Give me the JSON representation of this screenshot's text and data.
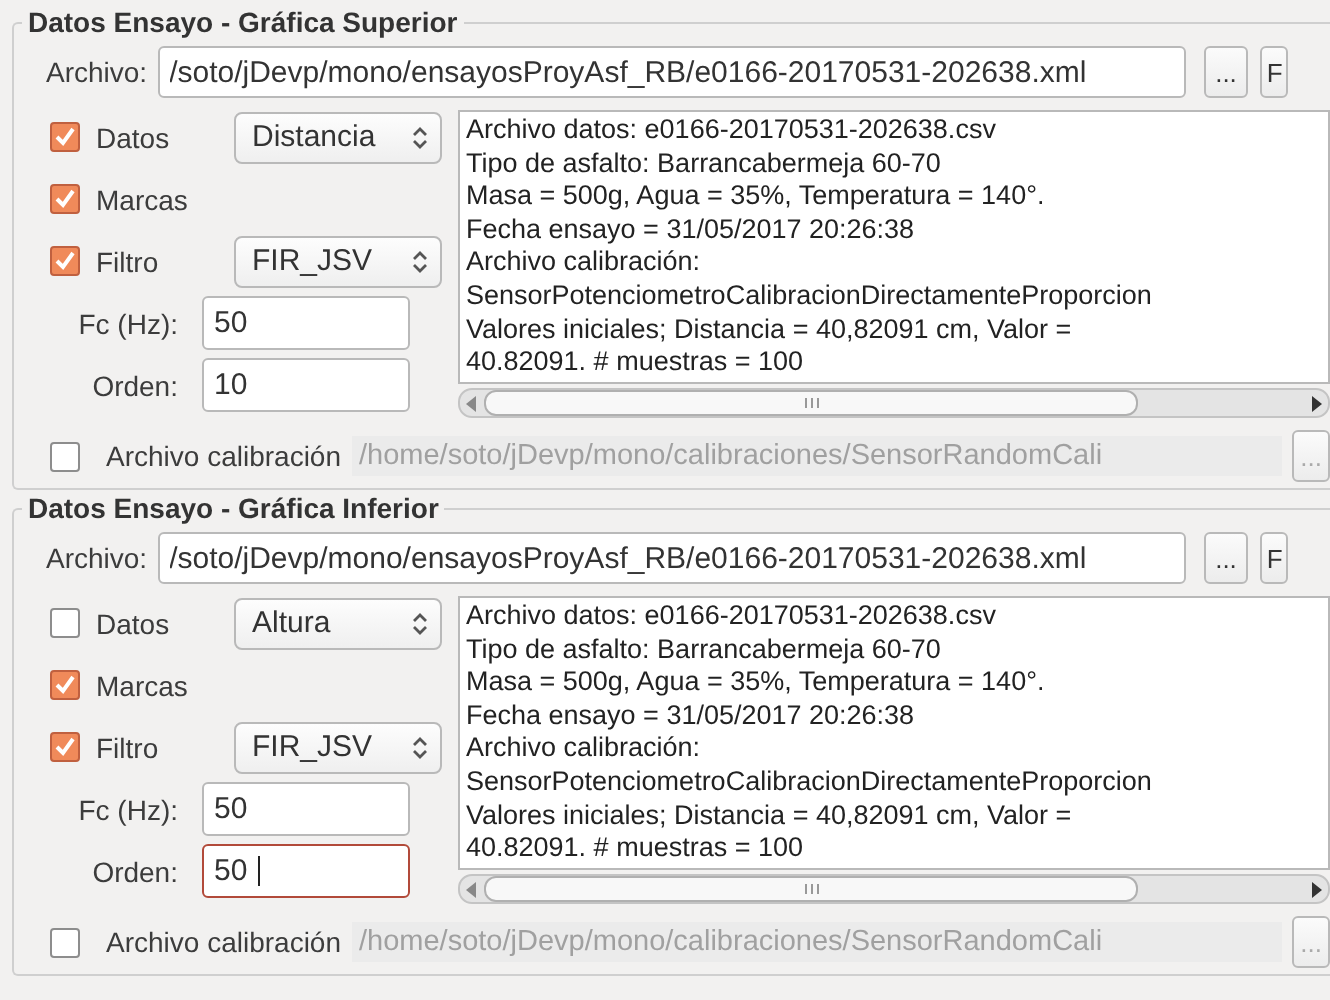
{
  "groups": [
    {
      "title": "Datos Ensayo - Gráfica Superior",
      "file": {
        "label": "Archivo:",
        "value": "/soto/jDevp/mono/ensayosProyAsf_RB/e0166-20170531-202638.xml"
      },
      "browse_button": "...",
      "extra_button": "F",
      "options": [
        {
          "kind": "checkbox-combo",
          "label": "Datos",
          "checked": true,
          "value": "Distancia"
        },
        {
          "kind": "checkbox",
          "label": "Marcas",
          "checked": true
        },
        {
          "kind": "checkbox-combo",
          "label": "Filtro",
          "checked": true,
          "value": "FIR_JSV"
        },
        {
          "kind": "field",
          "label": "Fc (Hz):",
          "value": "50",
          "focused": false
        },
        {
          "kind": "field",
          "label": "Orden:",
          "value": "10",
          "focused": false
        }
      ],
      "info_lines": [
        "Archivo datos: e0166-20170531-202638.csv",
        "Tipo de asfalto: Barrancabermeja 60-70",
        "Masa = 500g, Agua = 35%, Temperatura = 140°.",
        "Fecha ensayo = 31/05/2017 20:26:38",
        "Archivo calibración:",
        "SensorPotenciometroCalibracionDirectamenteProporcion",
        "Valores iniciales; Distancia = 40,82091 cm, Valor =",
        "40.82091. # muestras = 100"
      ],
      "calibration": {
        "label": "Archivo calibración",
        "checked": false,
        "path": "/home/soto/jDevp/mono/calibraciones/SensorRandomCali",
        "disabled": true,
        "button": "..."
      }
    },
    {
      "title": "Datos Ensayo - Gráfica Inferior",
      "file": {
        "label": "Archivo:",
        "value": "/soto/jDevp/mono/ensayosProyAsf_RB/e0166-20170531-202638.xml"
      },
      "browse_button": "...",
      "extra_button": "F",
      "options": [
        {
          "kind": "checkbox-combo",
          "label": "Datos",
          "checked": false,
          "value": "Altura"
        },
        {
          "kind": "checkbox",
          "label": "Marcas",
          "checked": true
        },
        {
          "kind": "checkbox-combo",
          "label": "Filtro",
          "checked": true,
          "value": "FIR_JSV"
        },
        {
          "kind": "field",
          "label": "Fc (Hz):",
          "value": "50",
          "focused": false
        },
        {
          "kind": "field",
          "label": "Orden:",
          "value": "50",
          "focused": true
        }
      ],
      "info_lines": [
        "Archivo datos: e0166-20170531-202638.csv",
        "Tipo de asfalto: Barrancabermeja 60-70",
        "Masa = 500g, Agua = 35%, Temperatura = 140°.",
        "Fecha ensayo = 31/05/2017 20:26:38",
        "Archivo calibración:",
        "SensorPotenciometroCalibracionDirectamenteProporcion",
        "Valores iniciales; Distancia = 40,82091 cm, Valor =",
        "40.82091. # muestras = 100"
      ],
      "calibration": {
        "label": "Archivo calibración",
        "checked": false,
        "path": "/home/soto/jDevp/mono/calibraciones/SensorRandomCali",
        "disabled": true,
        "button": "..."
      }
    }
  ]
}
